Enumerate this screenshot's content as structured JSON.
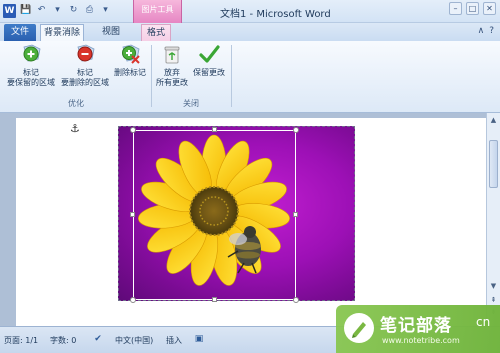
{
  "titlebar": {
    "app_icon_letter": "W",
    "qat": [
      {
        "icon": "save-icon",
        "glyph": "💾"
      },
      {
        "icon": "undo-icon",
        "glyph": "↶"
      },
      {
        "icon": "undo-dropdown-icon",
        "glyph": "▾"
      },
      {
        "icon": "redo-icon",
        "glyph": "↻"
      },
      {
        "icon": "print-icon",
        "glyph": "⎙"
      },
      {
        "icon": "customize-qat-icon",
        "glyph": "▾"
      }
    ],
    "context_tab_label": "图片工具",
    "title": "文档1 - Microsoft Word",
    "controls": {
      "minimize": "–",
      "maximize": "□",
      "close": "✕"
    }
  },
  "tabs": {
    "file": "文件",
    "background_removal": "背景消除",
    "view": "视图",
    "format": "格式",
    "help_glyph": "?",
    "minimize_ribbon_glyph": "∧"
  },
  "ribbon": {
    "buttons": {
      "mark_keep": {
        "line1": "标记",
        "line2": "要保留的区域",
        "icon": "plus-icon",
        "color": "#4caf3c"
      },
      "mark_remove": {
        "line1": "标记",
        "line2": "要删除的区域",
        "icon": "minus-icon",
        "color": "#d9342b"
      },
      "delete_mark": {
        "line1": "删除标记",
        "icon": "delete-mark-icon",
        "color": "#4caf3c"
      },
      "discard": {
        "line1": "放弃",
        "line2": "所有更改",
        "icon": "discard-icon"
      },
      "keep_changes": {
        "line1": "保留更改",
        "icon": "checkmark-icon",
        "color": "#3aa635"
      }
    },
    "groups": {
      "refine": "优化",
      "close": "关闭"
    }
  },
  "document": {
    "anchor_glyph": "⚓"
  },
  "statusbar": {
    "page": "页面: 1/1",
    "words": "字数: 0",
    "language": "中文(中国)",
    "insert_mode": "插入"
  },
  "watermark": {
    "title": "笔记部落",
    "url": "www.notetribe.com",
    "suffix": "cn"
  },
  "colors": {
    "accent_blue": "#2a5bb5",
    "picture_tools_pink": "#e686c3",
    "background_removal_magenta": "#b317c6",
    "watermark_green": "#7ab842"
  }
}
